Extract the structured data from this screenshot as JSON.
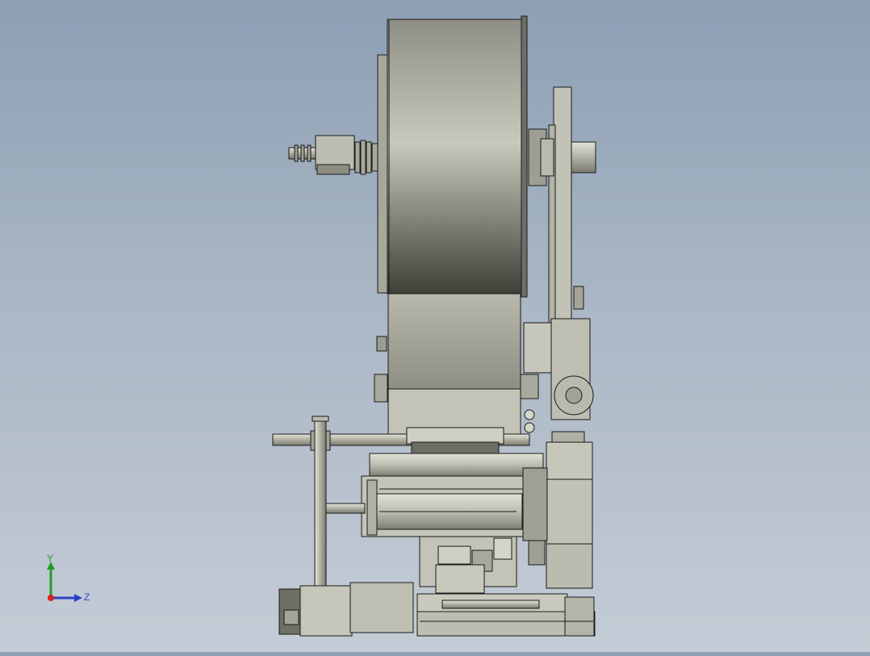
{
  "viewport": {
    "background_top": "#8c9fb4",
    "background_bottom": "#c4ccd6",
    "model_fill": "#c9c9bd",
    "model_edge": "#1a1a1a"
  },
  "triad": {
    "y_label": "Y",
    "z_label": "Z",
    "y_color": "#1ea01e",
    "z_color": "#2a40c8",
    "origin_color": "#d81e1e"
  }
}
